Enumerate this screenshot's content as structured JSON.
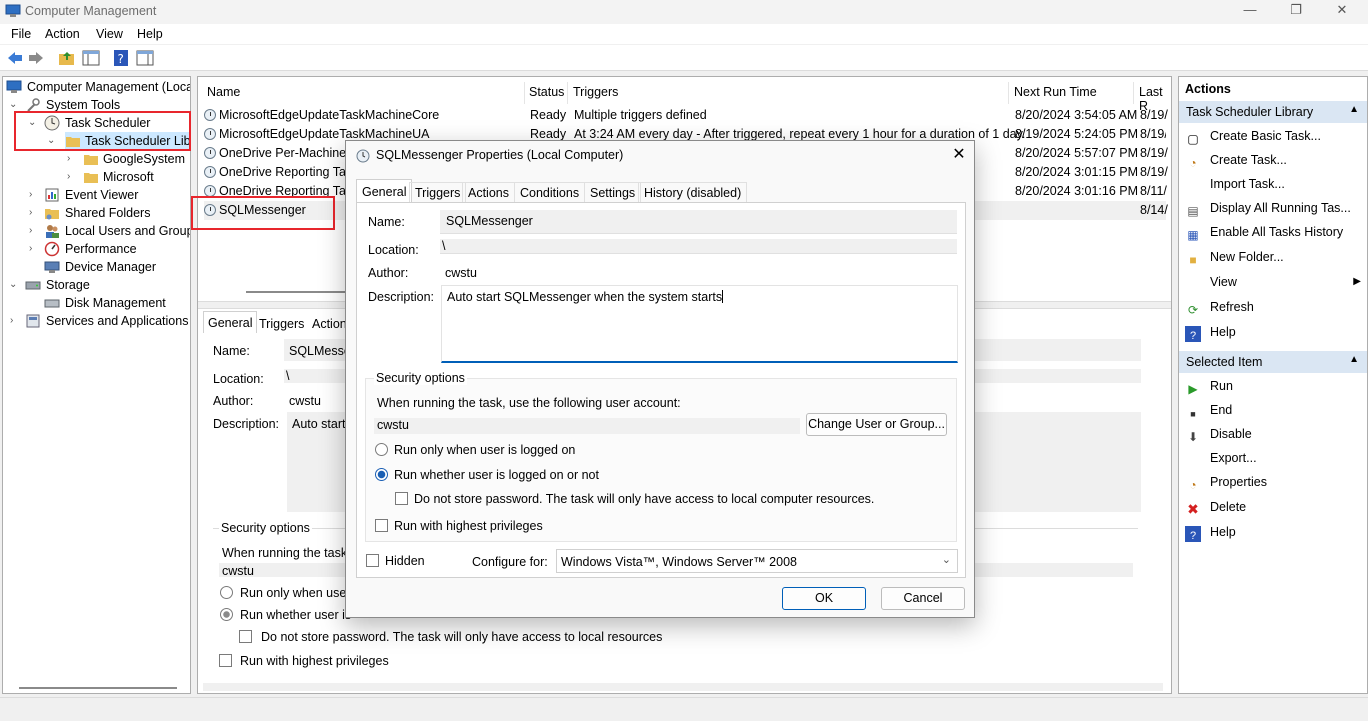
{
  "window": {
    "title": "Computer Management",
    "minimize": "—",
    "maximize": "❐",
    "close": "✕"
  },
  "menu": [
    "File",
    "Action",
    "View",
    "Help"
  ],
  "tree": {
    "root": "Computer Management (Local",
    "system_tools": "System Tools",
    "task_scheduler": "Task Scheduler",
    "task_scheduler_library": "Task Scheduler Libra",
    "google_system": "GoogleSystem",
    "microsoft": "Microsoft",
    "event_viewer": "Event Viewer",
    "shared_folders": "Shared Folders",
    "local_users": "Local Users and Groups",
    "performance": "Performance",
    "device_manager": "Device Manager",
    "storage": "Storage",
    "disk_management": "Disk Management",
    "services": "Services and Applications"
  },
  "tasks": {
    "columns": [
      "Name",
      "Status",
      "Triggers",
      "Next Run Time",
      "Last R"
    ],
    "rows": [
      {
        "name": "MicrosoftEdgeUpdateTaskMachineCore",
        "status": "Ready",
        "trigger": "Multiple triggers defined",
        "next": "8/20/2024 3:54:05 AM",
        "last": "8/19/"
      },
      {
        "name": "MicrosoftEdgeUpdateTaskMachineUA",
        "status": "Ready",
        "trigger": "At 3:24 AM every day - After triggered, repeat every 1 hour for a duration of 1 day.",
        "next": "8/19/2024 5:24:05 PM",
        "last": "8/19/"
      },
      {
        "name": "OneDrive Per-Machine",
        "status": "",
        "trigger": "",
        "next": "8/20/2024 5:57:07 PM",
        "last": "8/19/"
      },
      {
        "name": "OneDrive Reporting Tas",
        "status": "",
        "trigger": "",
        "next": "8/20/2024 3:01:15 PM",
        "last": "8/19/"
      },
      {
        "name": "OneDrive Reporting Tas",
        "status": "",
        "trigger": "",
        "next": "8/20/2024 3:01:16 PM",
        "last": "8/11/"
      },
      {
        "name": "SQLMessenger",
        "status": "",
        "trigger": "",
        "next": "",
        "last": "8/14/"
      }
    ]
  },
  "lower": {
    "tabs": [
      "General",
      "Triggers",
      "Action"
    ],
    "name_label": "Name:",
    "name_value": "SQLMesser",
    "location_label": "Location:",
    "location_value": "\\",
    "author_label": "Author:",
    "author_value": "cwstu",
    "description_label": "Description:",
    "description_value": "Auto start",
    "security_title": "Security options",
    "when_running": "When running the task,",
    "account": "cwstu",
    "run_only": "Run only when user",
    "run_whether": "Run whether user is",
    "no_store": "Do not store password.  The task will only have access to local resources",
    "highest": "Run with highest privileges"
  },
  "actions": {
    "header": "Actions",
    "section1": "Task Scheduler Library",
    "items1": [
      "Create Basic Task...",
      "Create Task...",
      "Import Task...",
      "Display All Running Tas...",
      "Enable All Tasks History",
      "New Folder...",
      "View",
      "Refresh",
      "Help"
    ],
    "section2": "Selected Item",
    "items2": [
      "Run",
      "End",
      "Disable",
      "Export...",
      "Properties",
      "Delete",
      "Help"
    ]
  },
  "dialog": {
    "title": "SQLMessenger Properties (Local Computer)",
    "tabs": [
      "General",
      "Triggers",
      "Actions",
      "Conditions",
      "Settings",
      "History (disabled)"
    ],
    "name_label": "Name:",
    "name_value": "SQLMessenger",
    "location_label": "Location:",
    "location_value": "\\",
    "author_label": "Author:",
    "author_value": "cwstu",
    "description_label": "Description:",
    "description_value": "Auto start SQLMessenger when the system starts",
    "security_title": "Security options",
    "when_running": "When running the task, use the following user account:",
    "account": "cwstu",
    "change_user": "Change User or Group...",
    "run_only": "Run only when user is logged on",
    "run_whether": "Run whether user is logged on or not",
    "no_store": "Do not store password.  The task will only have access to local computer resources.",
    "highest": "Run with highest privileges",
    "hidden": "Hidden",
    "configure_label": "Configure for:",
    "configure_value": "Windows Vista™, Windows Server™ 2008",
    "ok": "OK",
    "cancel": "Cancel"
  },
  "colors": {
    "highlight_box": "#e8262d",
    "accent": "#005fb8",
    "selection": "#cce8ff",
    "pane_header": "#dae6f3"
  }
}
